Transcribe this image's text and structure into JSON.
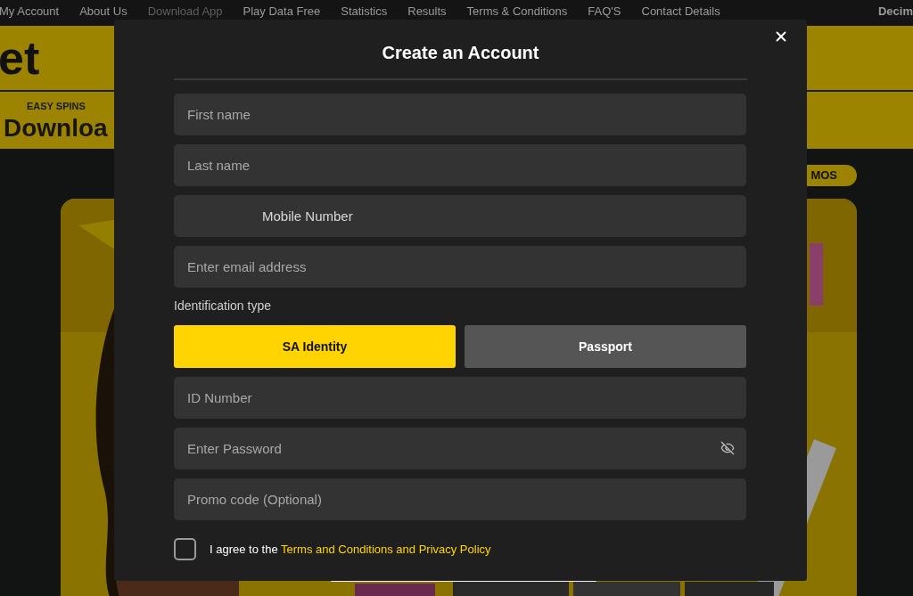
{
  "nav": {
    "items": [
      {
        "label": "My Account",
        "selected": false
      },
      {
        "label": "About Us",
        "selected": false
      },
      {
        "label": "Download App",
        "selected": true
      },
      {
        "label": "Play Data Free",
        "selected": false
      },
      {
        "label": "Statistics",
        "selected": false
      },
      {
        "label": "Results",
        "selected": false
      },
      {
        "label": "Terms & Conditions",
        "selected": false
      },
      {
        "label": "FAQ'S",
        "selected": false
      },
      {
        "label": "Contact Details",
        "selected": false
      }
    ],
    "right": "Decim"
  },
  "header": {
    "logo": "et",
    "strip_title": "EASY SPINS",
    "heading": "Downloa"
  },
  "promo_pill": "MOS",
  "modal": {
    "title": "Create an Account",
    "fields": [
      {
        "kind": "text",
        "placeholder": "First name"
      },
      {
        "kind": "text",
        "placeholder": "Last name"
      },
      {
        "kind": "phone",
        "placeholder": "Mobile Number"
      },
      {
        "kind": "text",
        "placeholder": "Enter email address"
      }
    ],
    "id_label": "Identification type",
    "id_types": [
      {
        "label": "SA Identity",
        "selected": true
      },
      {
        "label": "Passport",
        "selected": false
      }
    ],
    "fields_after": [
      {
        "kind": "text",
        "placeholder": "ID Number"
      },
      {
        "kind": "password",
        "placeholder": "Enter Password"
      },
      {
        "kind": "text",
        "placeholder": "Promo code (Optional)"
      }
    ],
    "agree": {
      "checked": false,
      "text": "I agree to the ",
      "link": "Terms and Conditions and Privacy Policy"
    }
  }
}
